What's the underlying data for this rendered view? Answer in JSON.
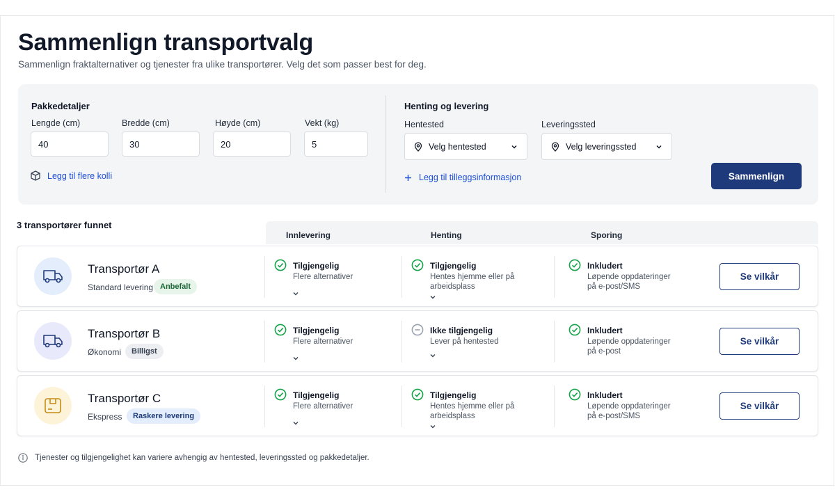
{
  "header": {
    "title": "Sammenlign transportvalg",
    "subtitle": "Sammenlign fraktalternativer og tjenester fra ulike transportører. Velg det som passer best for deg."
  },
  "package": {
    "title": "Pakkedetaljer",
    "length_label": "Lengde (cm)",
    "length_value": "40",
    "width_label": "Bredde (cm)",
    "width_value": "30",
    "height_label": "Høyde (cm)",
    "height_value": "20",
    "weight_label": "Vekt (kg)",
    "weight_value": "5",
    "add_parcels_link": "Legg til flere kolli"
  },
  "delivery": {
    "title": "Henting og levering",
    "pickup_label": "Hentested",
    "pickup_value": "Velg hentested",
    "dropoff_label": "Leveringssted",
    "dropoff_value": "Velg leveringssted",
    "add_info_link": "Legg til tilleggsinformasjon",
    "compare_button": "Sammenlign"
  },
  "results": {
    "count_text": "3 transportører funnet",
    "columns": [
      "Innlevering",
      "Henting",
      "Sporing"
    ],
    "carriers": [
      {
        "name": "Transportør A",
        "type": "Standard levering",
        "badge": "Anbefalt",
        "dropoff_title": "Tilgjengelig",
        "dropoff_sub": "Flere alternativer",
        "pickup_title": "Tilgjengelig",
        "pickup_sub": "Hentes hjemme eller på arbeidsplass",
        "tracking_title": "Inkludert",
        "tracking_sub": "Løpende oppdateringer på e-post/SMS",
        "button": "Se vilkår"
      },
      {
        "name": "Transportør B",
        "type": "Økonomi",
        "badge": "Billigst",
        "dropoff_title": "Tilgjengelig",
        "dropoff_sub": "Flere alternativer",
        "pickup_title": "Ikke tilgjengelig",
        "pickup_sub": "Lever på hentested",
        "tracking_title": "Inkludert",
        "tracking_sub": "Løpende oppdateringer på e-post",
        "button": "Se vilkår"
      },
      {
        "name": "Transportør C",
        "type": "Ekspress",
        "badge": "Raskere levering",
        "dropoff_title": "Tilgjengelig",
        "dropoff_sub": "Flere alternativer",
        "pickup_title": "Tilgjengelig",
        "pickup_sub": "Hentes hjemme eller på arbeidsplass",
        "tracking_title": "Inkludert",
        "tracking_sub": "Løpende oppdateringer på e-post/SMS",
        "button": "Se vilkår"
      }
    ]
  },
  "footnote": "Tjenester og tilgjengelighet kan variere avhengig av hentested, leveringssted og pakkedetaljer.",
  "colors": {
    "primary": "#1e3a7b",
    "link": "#1d4ed8",
    "available": "#16a34a",
    "unavailable": "#9ca3af",
    "badge_recommended_bg": "#e6f4ea",
    "badge_cheapest_bg": "#eceef1",
    "badge_express_bg": "#e3edfb"
  },
  "icons": {
    "carrier_a": "truck-icon",
    "carrier_b": "truck-icon",
    "carrier_c": "package-icon"
  }
}
